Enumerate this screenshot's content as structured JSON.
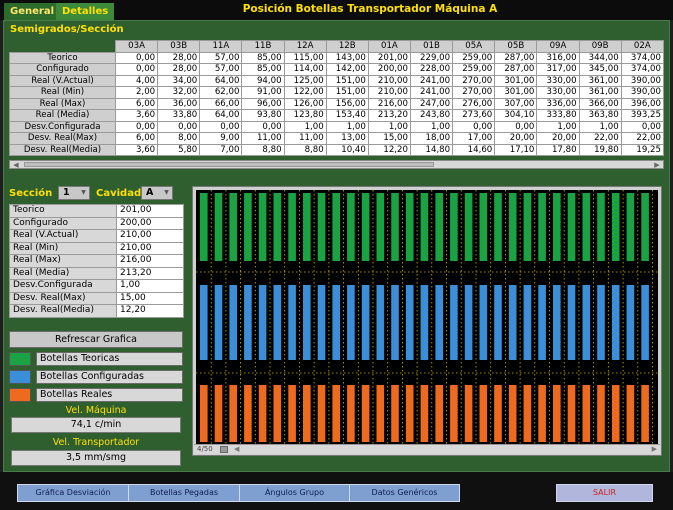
{
  "tabs": [
    {
      "label": "General",
      "active": false
    },
    {
      "label": "Detalles",
      "active": true
    }
  ],
  "title": "Posición Botellas Transportador Máquina A",
  "semigrados": {
    "label": "Semigrados/Sección",
    "columns": [
      "03A",
      "03B",
      "11A",
      "11B",
      "12A",
      "12B",
      "01A",
      "01B",
      "05A",
      "05B",
      "09A",
      "09B",
      "02A"
    ],
    "rows": [
      {
        "label": "Teorico",
        "values": [
          "0,00",
          "28,00",
          "57,00",
          "85,00",
          "115,00",
          "143,00",
          "201,00",
          "229,00",
          "259,00",
          "287,00",
          "316,00",
          "344,00",
          "374,00"
        ]
      },
      {
        "label": "Configurado",
        "values": [
          "0,00",
          "28,00",
          "57,00",
          "85,00",
          "114,00",
          "142,00",
          "200,00",
          "228,00",
          "259,00",
          "287,00",
          "317,00",
          "345,00",
          "374,00"
        ]
      },
      {
        "label": "Real (V.Actual)",
        "values": [
          "4,00",
          "34,00",
          "64,00",
          "94,00",
          "125,00",
          "151,00",
          "210,00",
          "241,00",
          "270,00",
          "301,00",
          "330,00",
          "361,00",
          "390,00"
        ]
      },
      {
        "label": "Real (Min)",
        "values": [
          "2,00",
          "32,00",
          "62,00",
          "91,00",
          "122,00",
          "151,00",
          "210,00",
          "241,00",
          "270,00",
          "301,00",
          "330,00",
          "361,00",
          "390,00"
        ]
      },
      {
        "label": "Real (Max)",
        "values": [
          "6,00",
          "36,00",
          "66,00",
          "96,00",
          "126,00",
          "156,00",
          "216,00",
          "247,00",
          "276,00",
          "307,00",
          "336,00",
          "366,00",
          "396,00"
        ]
      },
      {
        "label": "Real (Media)",
        "values": [
          "3,60",
          "33,80",
          "64,00",
          "93,80",
          "123,80",
          "153,40",
          "213,20",
          "243,80",
          "273,60",
          "304,10",
          "333,80",
          "363,80",
          "393,25"
        ]
      },
      {
        "label": "Desv.Configurada",
        "values": [
          "0,00",
          "0,00",
          "0,00",
          "0,00",
          "1,00",
          "1,00",
          "1,00",
          "1,00",
          "0,00",
          "0,00",
          "1,00",
          "1,00",
          "0,00"
        ]
      },
      {
        "label": "Desv. Real(Max)",
        "values": [
          "6,00",
          "8,00",
          "9,00",
          "11,00",
          "11,00",
          "13,00",
          "15,00",
          "18,00",
          "17,00",
          "20,00",
          "20,00",
          "22,00",
          "22,00"
        ]
      },
      {
        "label": "Desv. Real(Media)",
        "values": [
          "3,60",
          "5,80",
          "7,00",
          "8,80",
          "8,80",
          "10,40",
          "12,20",
          "14,80",
          "14,60",
          "17,10",
          "17,80",
          "19,80",
          "19,25"
        ]
      }
    ]
  },
  "seccion": {
    "label": "Sección",
    "value": "1"
  },
  "cavidad": {
    "label": "Cavidad",
    "value": "A"
  },
  "summary": [
    {
      "label": "Teorico",
      "value": "201,00"
    },
    {
      "label": "Configurado",
      "value": "200,00"
    },
    {
      "label": "Real (V.Actual)",
      "value": "210,00"
    },
    {
      "label": "Real (Min)",
      "value": "210,00"
    },
    {
      "label": "Real (Max)",
      "value": "216,00"
    },
    {
      "label": "Real (Media)",
      "value": "213,20"
    },
    {
      "label": "Desv.Configurada",
      "value": "1,00"
    },
    {
      "label": "Desv. Real(Max)",
      "value": "15,00"
    },
    {
      "label": "Desv. Real(Media)",
      "value": "12,20"
    }
  ],
  "refresh_label": "Refrescar Grafica",
  "legend": [
    {
      "label": "Botellas Teoricas",
      "color": "#1aa342"
    },
    {
      "label": "Botellas Configuradas",
      "color": "#3a8fd8"
    },
    {
      "label": "Botellas Reales",
      "color": "#ee6a1e"
    }
  ],
  "vel_maquina": {
    "label": "Vel. Máquina",
    "value": "74,1 c/min"
  },
  "vel_transportador": {
    "label": "Vel. Transportador",
    "value": "3,5 mm/smg"
  },
  "chart_zoom_label": "4/50",
  "buttons": {
    "grafica_desviacion": "Gráfica Desviación",
    "botellas_pegadas": "Botellas Pegadas",
    "angulos_grupo": "Ángulos Grupo",
    "datos_genericos": "Datos Genéricos",
    "salir": "SALIR"
  },
  "colors": {
    "panel": "#2f5f2f",
    "accent": "#ffe000",
    "teorica": "#1aa342",
    "configurada": "#3a8fd8",
    "real": "#ee6a1e"
  }
}
